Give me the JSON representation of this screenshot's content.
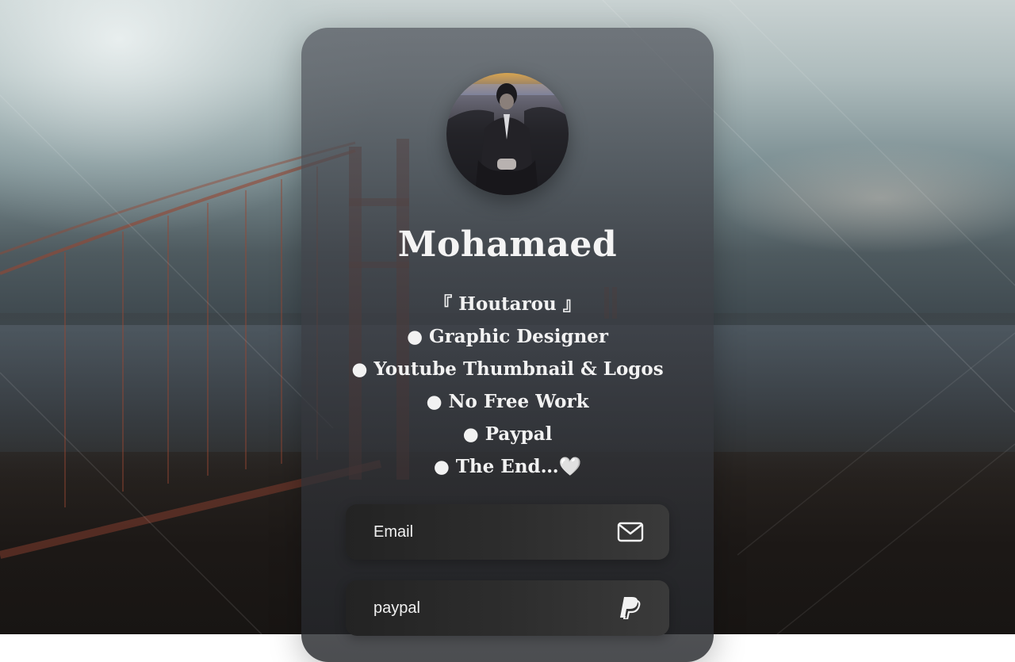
{
  "profile": {
    "name": "Mohamaed",
    "bio": [
      "『 Houtarou 』",
      "● Graphic Designer",
      "● Youtube Thumbnail & Logos",
      "● No Free Work",
      "● Paypal",
      "● The End…🤍"
    ]
  },
  "links": [
    {
      "label": "Email",
      "icon": "mail-icon"
    },
    {
      "label": "paypal",
      "icon": "paypal-icon"
    }
  ],
  "colors": {
    "card_bg": "#4a4e56",
    "link_bg": "#2d2d2d",
    "text": "#f4f4f4"
  }
}
